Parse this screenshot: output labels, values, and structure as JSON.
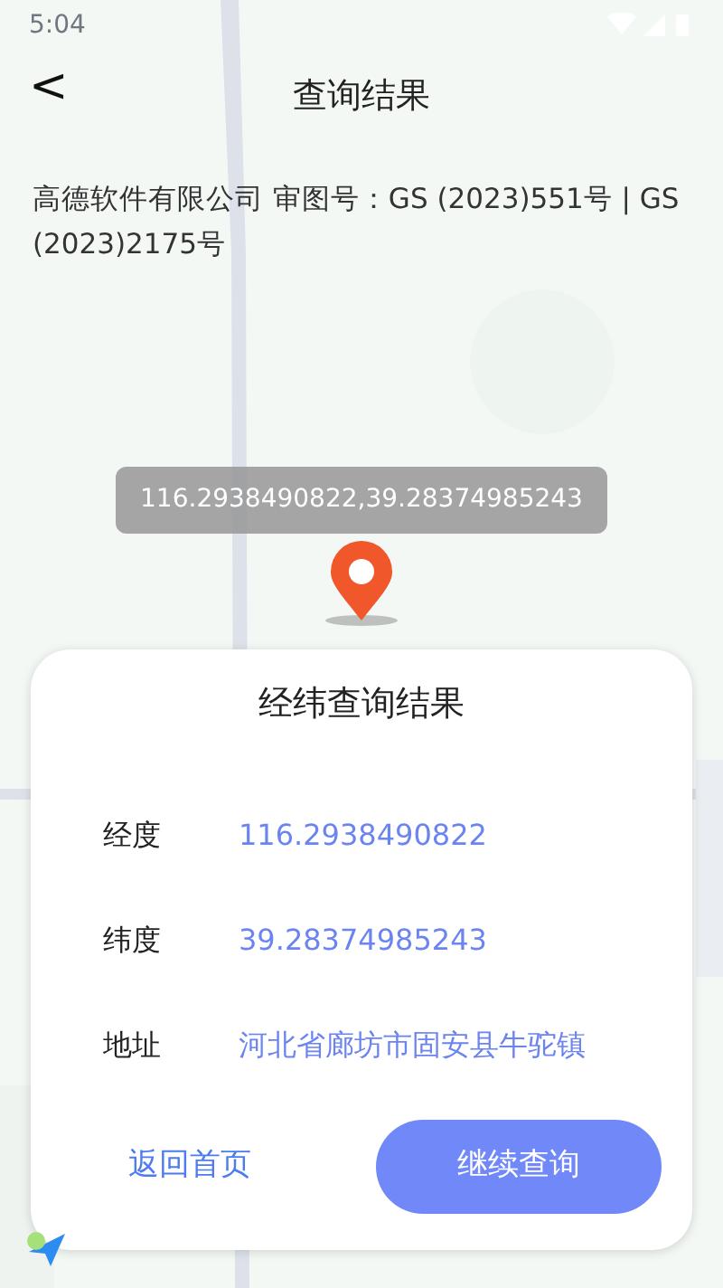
{
  "status_bar": {
    "time": "5:04"
  },
  "header": {
    "back": "<",
    "title": "查询结果"
  },
  "map": {
    "kind": "picture",
    "attribution": "高德软件有限公司 审图号：GS (2023)551号 | GS (2023)2175号",
    "marker_label": "116.2938490822,39.28374985243"
  },
  "result_card": {
    "title": "经纬查询结果",
    "rows": [
      {
        "label": "经度",
        "value": "116.2938490822"
      },
      {
        "label": "纬度",
        "value": "39.28374985243"
      },
      {
        "label": "地址",
        "value": "河北省廊坊市固安县牛驼镇"
      }
    ],
    "buttons": [
      {
        "label": "返回首页",
        "kind": "link"
      },
      {
        "label": "继续查询",
        "kind": "primary"
      }
    ]
  }
}
